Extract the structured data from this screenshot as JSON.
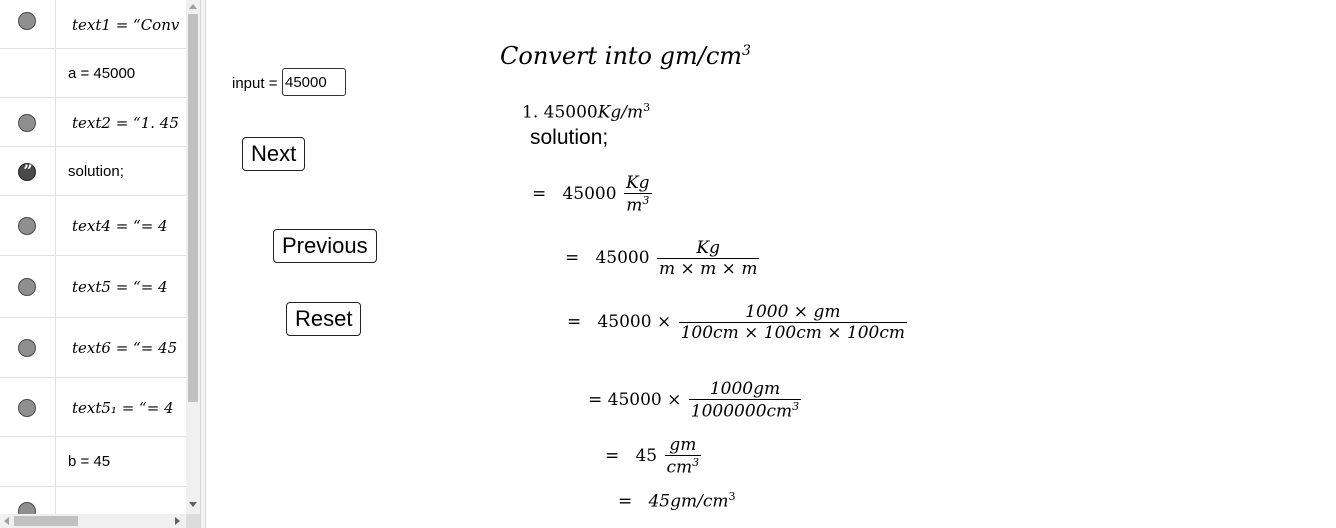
{
  "algebra": {
    "rows": [
      {
        "type": "circle",
        "text": "text1  =  “Conv",
        "math": true
      },
      {
        "type": "none",
        "text": "a = 45000",
        "math": false
      },
      {
        "type": "circle",
        "text": "text2  =  “1.  45",
        "math": true
      },
      {
        "type": "quote",
        "text": "solution;",
        "math": false
      },
      {
        "type": "circle",
        "text": "text4  =  “=  4",
        "math": true
      },
      {
        "type": "circle",
        "text": "text5  =  “=  4",
        "math": true
      },
      {
        "type": "circle",
        "text": "text6  =  “= 45",
        "math": true
      },
      {
        "type": "circle",
        "text": "text5₁  =  “=  4",
        "math": true
      },
      {
        "type": "none",
        "text": "b = 45",
        "math": false
      },
      {
        "type": "circle",
        "text": "",
        "math": true
      }
    ]
  },
  "graphics": {
    "input_label": "input =",
    "input_value": "45000",
    "buttons": {
      "next": "Next",
      "previous": "Previous",
      "reset": "Reset"
    },
    "title": {
      "main": "Convert into gm/cm",
      "exp": "3"
    },
    "problem": {
      "prefix": "1. ",
      "value": "45000",
      "unit": "Kg/m",
      "exp": "3"
    },
    "solution_label": "solution;",
    "step1": {
      "lead": "= ",
      "value": "45000",
      "num": "Kg",
      "den": "m",
      "den_exp": "3"
    },
    "step2": {
      "lead": "= ",
      "value": "45000",
      "num": "Kg",
      "den": "m × m × m"
    },
    "step3": {
      "lead": "= ",
      "value": "45000 ×",
      "num": "1000 × gm",
      "den": "100cm × 100cm × 100cm"
    },
    "step4": {
      "lead": "= ",
      "value": "45000 ×",
      "num": "1000gm",
      "den": "1000000cm",
      "den_exp": "3"
    },
    "step5": {
      "lead": "= ",
      "value": "45",
      "num": "gm",
      "den": "cm",
      "den_exp": "3"
    },
    "step6": {
      "lead": "= ",
      "value": "45gm/cm",
      "exp": "3"
    }
  }
}
